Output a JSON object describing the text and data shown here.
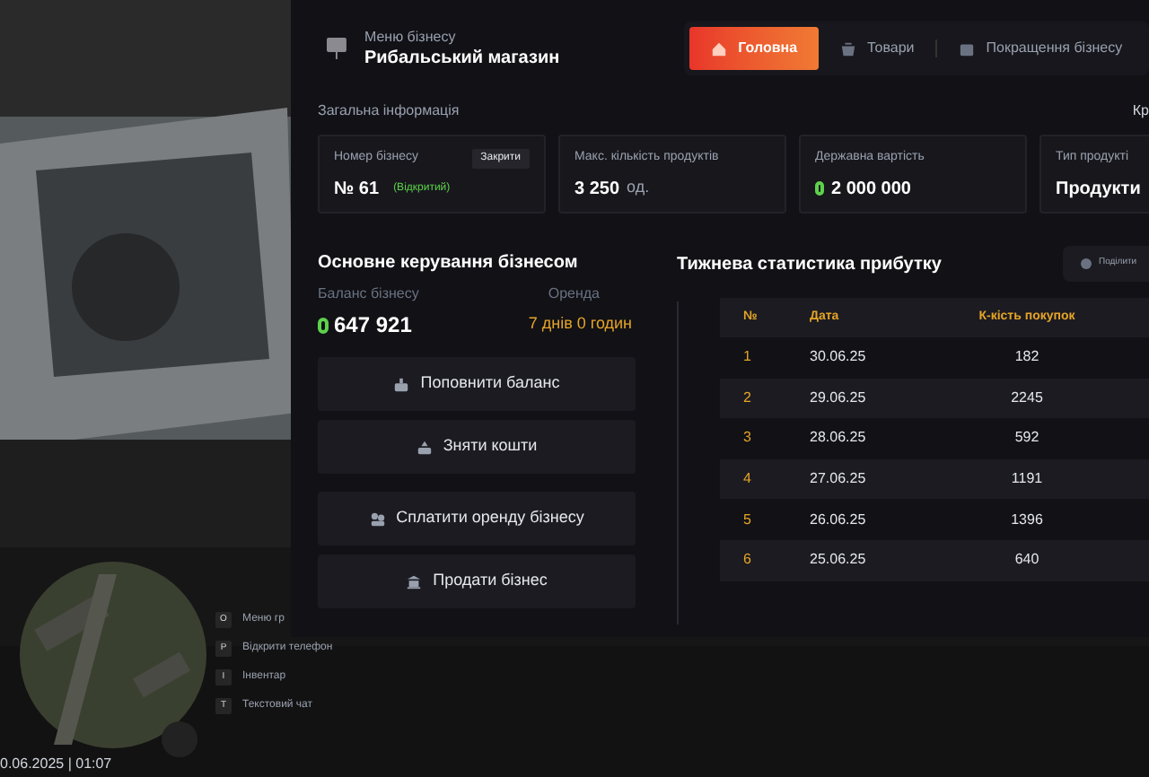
{
  "hud": {
    "hints": [
      {
        "key": "O",
        "label": "Меню гр"
      },
      {
        "key": "P",
        "label": "Відкрити телефон"
      },
      {
        "key": "I",
        "label": "Інвентар"
      },
      {
        "key": "T",
        "label": "Текстовий чат"
      }
    ],
    "datetime": "0.06.2025 | 01:07"
  },
  "header": {
    "subtitle": "Меню бізнесу",
    "title": "Рибальський магазин"
  },
  "tabs": [
    {
      "label": "Головна",
      "selected": true,
      "kind": "home"
    },
    {
      "label": "Товари",
      "selected": false,
      "kind": "basket"
    },
    {
      "label": "Покращення бізнесу",
      "selected": false,
      "kind": "wallet"
    }
  ],
  "info": {
    "title": "Загальна інформація",
    "right_label": "Кр",
    "cards": [
      {
        "kind": "number",
        "label": "Номер бізнесу",
        "prefix": "№",
        "value": "61",
        "status": "(Відкритий)",
        "button": "Закрити"
      },
      {
        "kind": "plain",
        "label": "Макс. кількість продуктів",
        "value": "3 250",
        "unit": "од."
      },
      {
        "kind": "money",
        "label": "Державна вартість",
        "value": "2 000 000"
      },
      {
        "kind": "plain",
        "label": "Тип продукті",
        "value": "Продукти"
      }
    ]
  },
  "management": {
    "title": "Основне керування бізнесом",
    "balance_label": "Баланс бізнесу",
    "balance": "647 921",
    "rent_label": "Оренда",
    "rent": "7 днів 0 годин",
    "buttons": [
      {
        "label": "Поповнити баланс",
        "kind": "deposit"
      },
      {
        "label": "Зняти кошти",
        "kind": "withdraw"
      },
      {
        "label": "Сплатити оренду бізнесу",
        "kind": "people"
      },
      {
        "label": "Продати бізнес",
        "kind": "bank"
      }
    ]
  },
  "stats": {
    "title": "Тижнева статистика прибутку",
    "share": "Поділити",
    "columns": [
      "№",
      "Дата",
      "К-кість покупок"
    ],
    "rows": [
      [
        "1",
        "30.06.25",
        "182"
      ],
      [
        "2",
        "29.06.25",
        "2245"
      ],
      [
        "3",
        "28.06.25",
        "592"
      ],
      [
        "4",
        "27.06.25",
        "1191"
      ],
      [
        "5",
        "26.06.25",
        "1396"
      ],
      [
        "6",
        "25.06.25",
        "640"
      ]
    ]
  }
}
